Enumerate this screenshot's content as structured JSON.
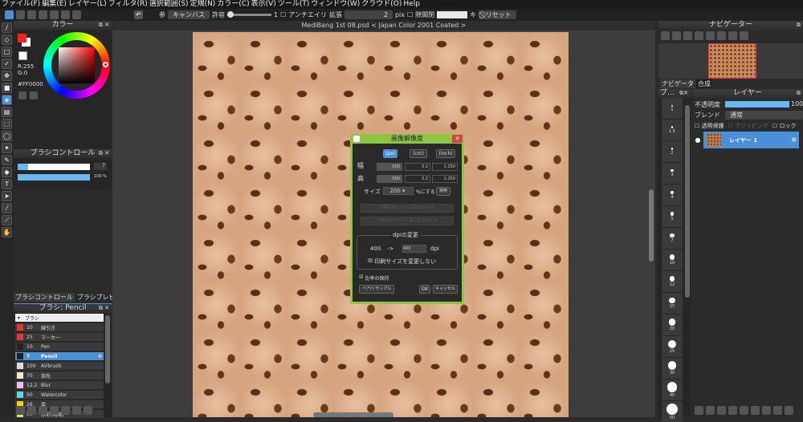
{
  "menu": [
    "ファイル(F)",
    "編集(E)",
    "レイヤー(L)",
    "フィルタ(R)",
    "選択範囲(S)",
    "定規(N)",
    "カラー(C)",
    "表示(V)",
    "ツール(T)",
    "ウィンドウ(W)",
    "クラウド(O)",
    "Help"
  ],
  "toolbar": {
    "ref_label": "参",
    "ref_value": "キャンバス",
    "tolerance_label": "許容",
    "tolerance_value": "1",
    "antialias": "アンチエイリ",
    "expand_label": "拡張",
    "expand_value": "2",
    "expand_unit": "pix",
    "gap_label": "隙間閉",
    "key_label": "キ",
    "reset": "リセット"
  },
  "color": {
    "title": "カラー",
    "r": "R:255",
    "g": "G:0",
    "hex": "#FF0000",
    "fg": "#ff2010",
    "bg": "#ffffff"
  },
  "brush_control": {
    "title": "ブラシコントロール",
    "size": "7",
    "opacity": "100 %",
    "size_fraction": 0.14,
    "opacity_fraction": 1.0
  },
  "left_tabs": [
    "ブラシコントロール",
    "ブラシプレビュー"
  ],
  "brush_panel": {
    "title": "ブラシ: Pencil",
    "header": "ブラシ",
    "items": [
      {
        "size": "10",
        "name": "線引き",
        "color": "#e8352a"
      },
      {
        "size": "25",
        "name": "マーカー",
        "color": "#e8352a"
      },
      {
        "size": "10",
        "name": "Pen",
        "color": "#222222"
      },
      {
        "size": "7",
        "name": "Pencil",
        "color": "#222222",
        "active": true
      },
      {
        "size": "100",
        "name": "Airbrush",
        "color": "#dddddd"
      },
      {
        "size": "70",
        "name": "指先",
        "color": "#f7e6d4"
      },
      {
        "size": "12.2",
        "name": "Blur",
        "color": "#f7b8ef"
      },
      {
        "size": "50",
        "name": "Watercolor",
        "color": "#5fd3f5"
      },
      {
        "size": "26",
        "name": "雲",
        "color": "#f5d400"
      },
      {
        "size": "50",
        "name": "水彩(明暗)",
        "color": "#c8e86a"
      }
    ]
  },
  "document": {
    "title": "MediBang 1st 08.psd < Japan Color 2001 Coated >"
  },
  "dialog": {
    "title": "画像解像度",
    "units": [
      "(px)",
      "(cm)",
      "(inch)"
    ],
    "width_label": "幅",
    "height_label": "高",
    "width_px": "500",
    "height_px": "500",
    "width_cm": "3.2",
    "height_cm": "3.2",
    "width_in": "1.250",
    "height_in": "1.250",
    "size_label": "サイズ",
    "size_value": "200",
    "size_suffix": "%にする",
    "apply": "適用",
    "guide1": "印刷原稿ガイドに幅を合わせる",
    "guide2": "印刷原稿ガイドに高さを合わせる",
    "dpi_title": "dpiの変更",
    "dpi_from": "400",
    "arrow": "->",
    "dpi_to": "400",
    "dpi_unit": "dpi",
    "keep_print": "印刷サイズを変更しない",
    "keep_ratio": "比率の保持",
    "resample": "ペア/リサンプル",
    "ok": "OK",
    "cancel": "キャンセル"
  },
  "navigator": {
    "title": "ナビゲーター",
    "tabs": [
      "ナビゲータ",
      "合成"
    ]
  },
  "brush_sizes": {
    "title": "ブ…",
    "sizes": [
      "1",
      "1.5",
      "2",
      "3",
      "4",
      "5",
      "7",
      "10",
      "12",
      "15",
      "20",
      "25",
      "30",
      "40",
      "50"
    ]
  },
  "layers": {
    "title": "レイヤー",
    "opacity_label": "不透明度",
    "opacity_value": "100",
    "blend_label": "ブレンド",
    "blend_value": "通常",
    "protect": "透明保護",
    "clip": "クリッピング",
    "lock": "ロック",
    "items": [
      {
        "name": "レイヤー 1",
        "active": true
      }
    ]
  },
  "accent": "#4a90d9",
  "dialog_border": "#8dc63f"
}
